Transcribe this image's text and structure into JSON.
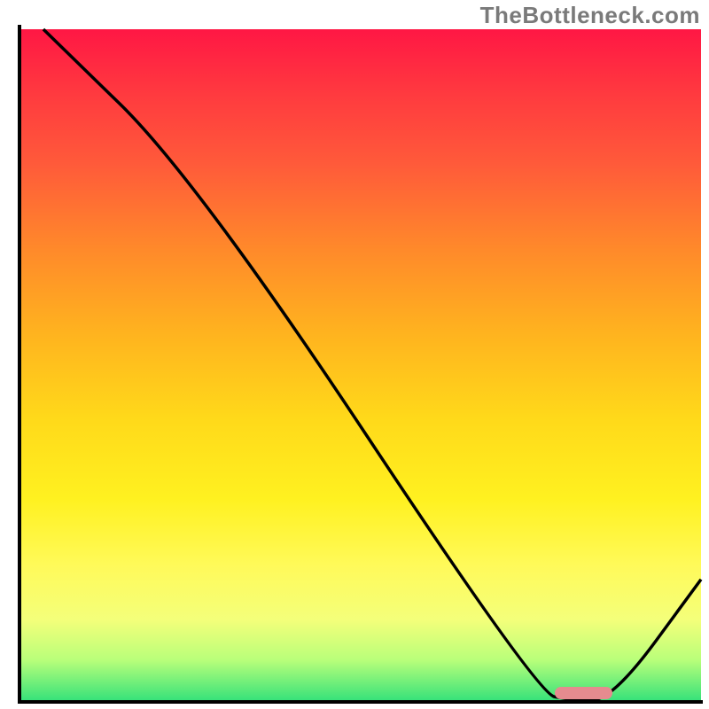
{
  "watermark": "TheBottleneck.com",
  "chart_data": {
    "type": "line",
    "title": "",
    "xlabel": "",
    "ylabel": "",
    "xlim": [
      0,
      100
    ],
    "ylim": [
      0,
      100
    ],
    "grid": false,
    "curve_points_pct": [
      {
        "x": 3.5,
        "y": 100.0
      },
      {
        "x": 26.0,
        "y": 77.7
      },
      {
        "x": 76.0,
        "y": 1.0
      },
      {
        "x": 81.0,
        "y": 0.0
      },
      {
        "x": 87.0,
        "y": 0.0
      },
      {
        "x": 100.0,
        "y": 18.0
      }
    ],
    "marker": {
      "x_start_pct": 78.5,
      "x_end_pct": 87.0,
      "y_pct": 1.0
    },
    "background_gradient": {
      "type": "vertical",
      "stops": [
        {
          "pos": 0.0,
          "color": "#ff1744"
        },
        {
          "pos": 0.33,
          "color": "#ff8a2a"
        },
        {
          "pos": 0.7,
          "color": "#fff120"
        },
        {
          "pos": 0.94,
          "color": "#b9ff7a"
        },
        {
          "pos": 1.0,
          "color": "#38e27a"
        }
      ]
    }
  }
}
